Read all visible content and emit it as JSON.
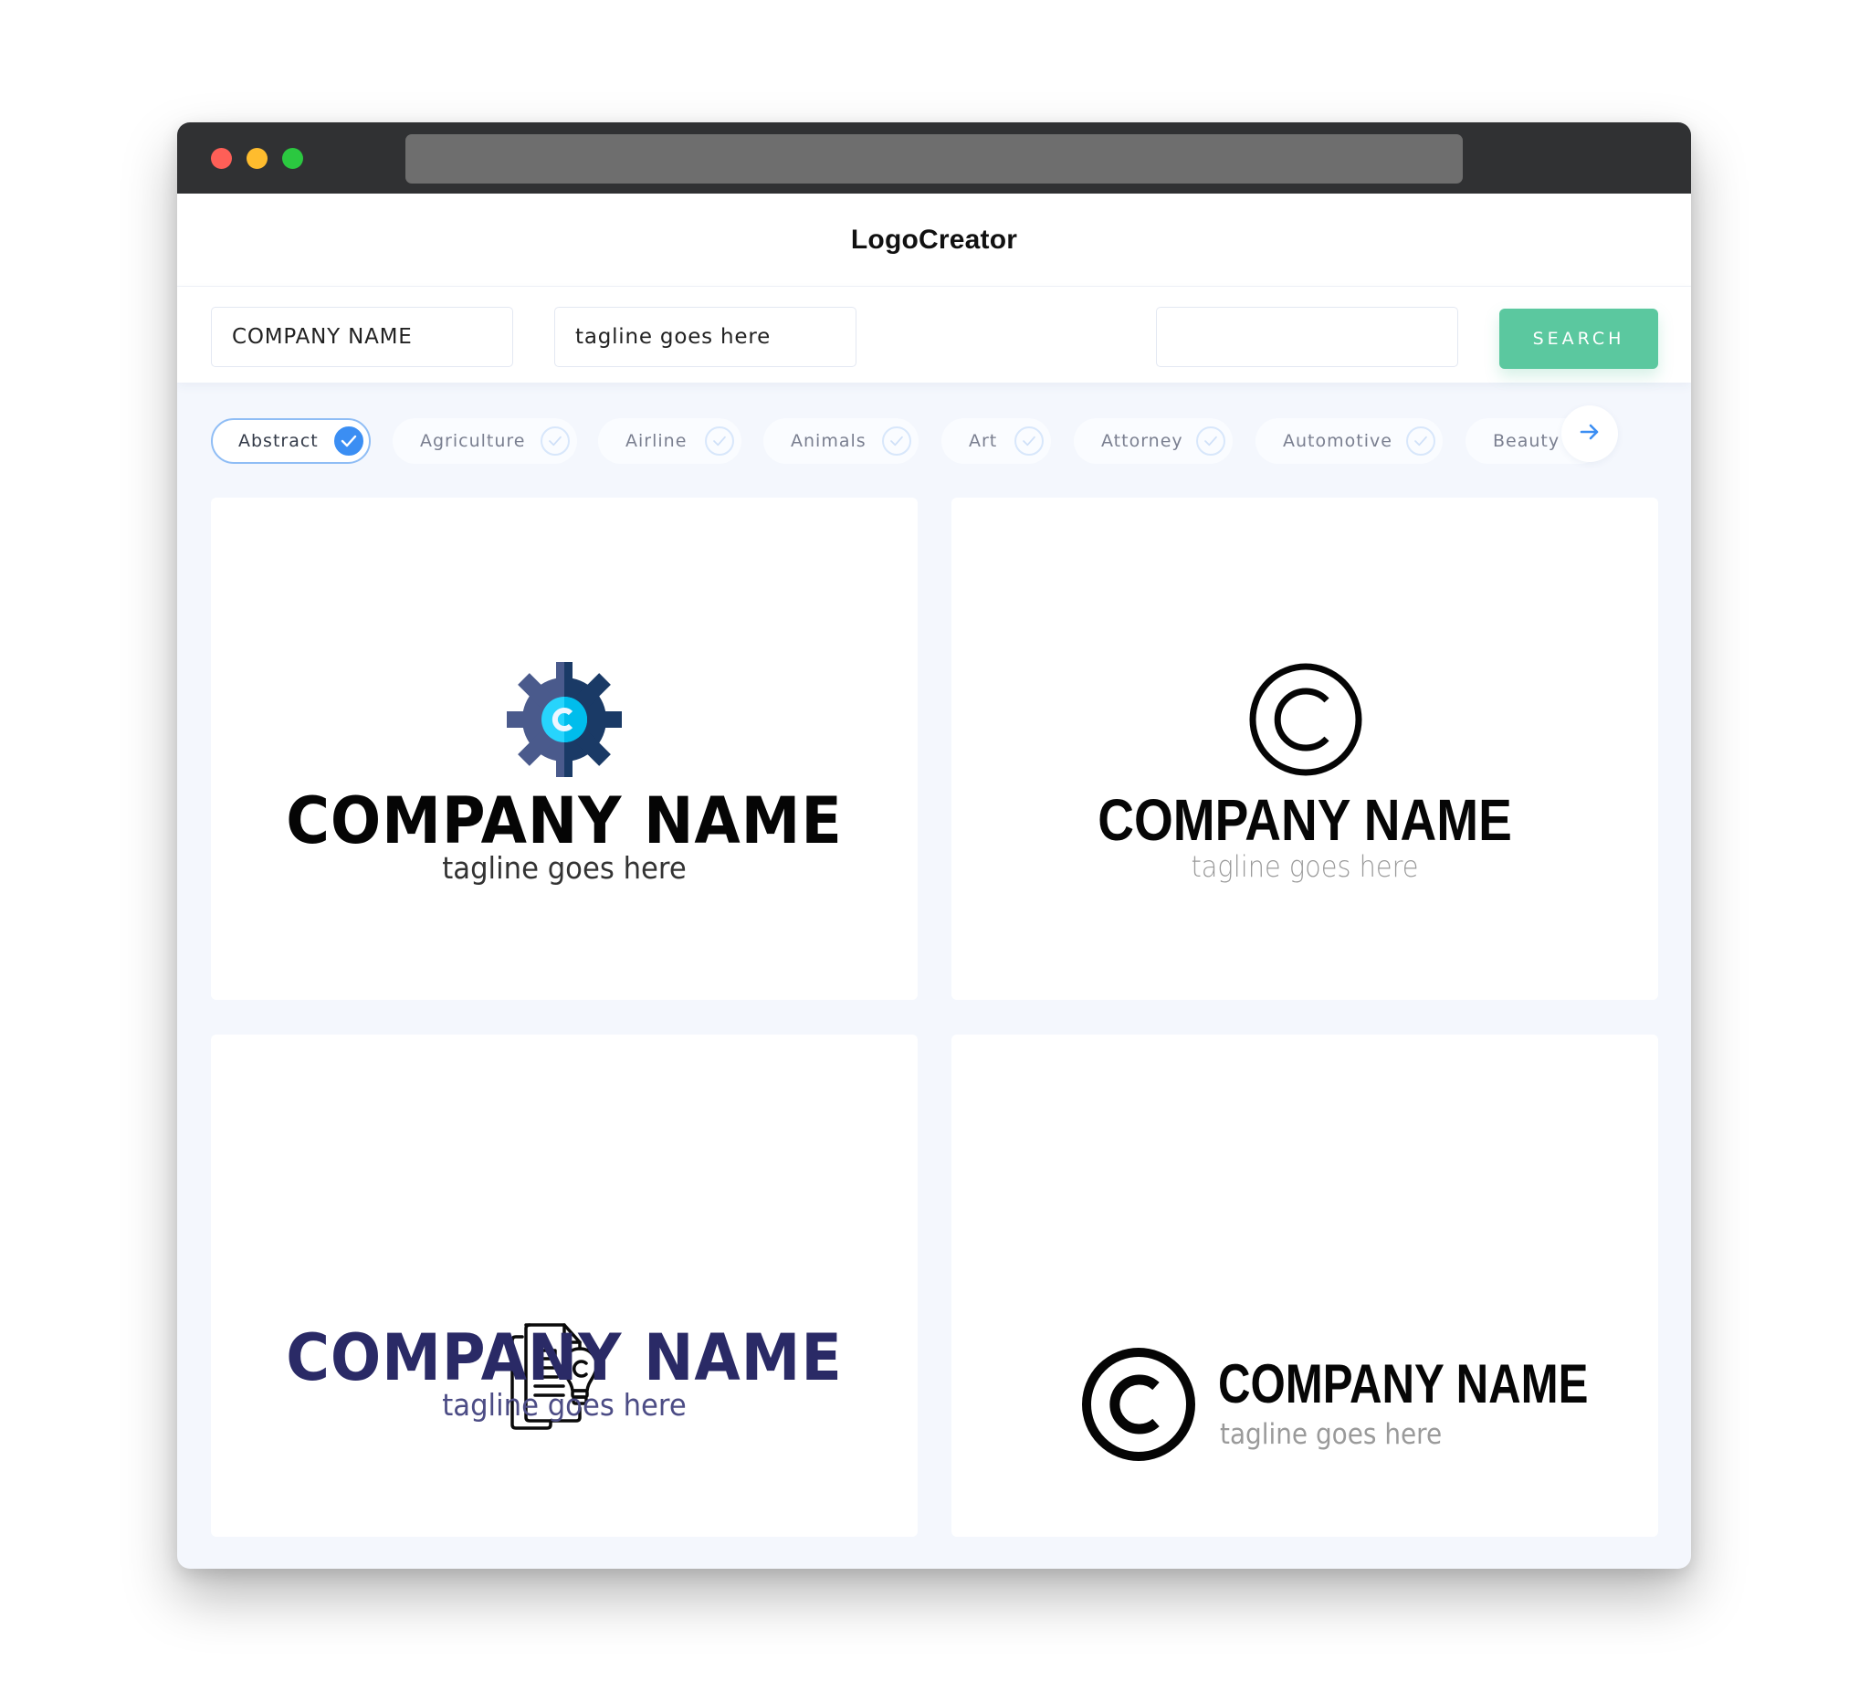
{
  "window": {
    "traffic_lights": [
      "close",
      "minimize",
      "maximize"
    ],
    "url": ""
  },
  "header": {
    "title": "LogoCreator"
  },
  "search": {
    "company_name_value": "COMPANY NAME",
    "tagline_value": "tagline goes here",
    "extra_value": "",
    "search_label": "SEARCH"
  },
  "categories": {
    "items": [
      {
        "label": "Abstract",
        "selected": true
      },
      {
        "label": "Agriculture",
        "selected": false
      },
      {
        "label": "Airline",
        "selected": false
      },
      {
        "label": "Animals",
        "selected": false
      },
      {
        "label": "Art",
        "selected": false
      },
      {
        "label": "Attorney",
        "selected": false
      },
      {
        "label": "Automotive",
        "selected": false
      },
      {
        "label": "Beauty",
        "selected": false
      }
    ],
    "next_icon": "arrow-right-icon"
  },
  "colors": {
    "accent_green": "#5bc89f",
    "accent_blue": "#3b8ef3",
    "navy": "#2a2a66",
    "gear_left": "#4a5a8c",
    "gear_right": "#1a3a66",
    "gear_center": "#1ec8f5"
  },
  "logos": [
    {
      "icon": "gear-copyright-icon",
      "company": "COMPANY NAME",
      "tagline": "tagline goes here"
    },
    {
      "icon": "copyright-circle-icon",
      "company": "COMPANY NAME",
      "tagline": "tagline goes here"
    },
    {
      "icon": "document-lightbulb-icon",
      "company": "COMPANY NAME",
      "tagline": "tagline goes here"
    },
    {
      "icon": "copyright-circle-icon",
      "company": "COMPANY NAME",
      "tagline": "tagline goes here"
    }
  ]
}
